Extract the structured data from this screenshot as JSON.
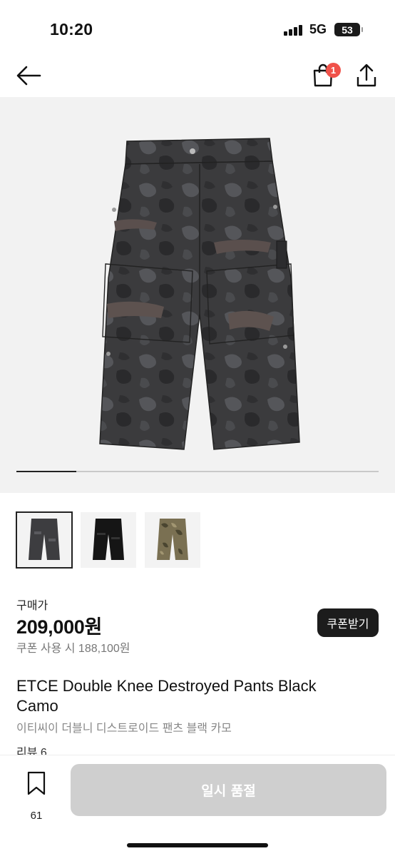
{
  "status": {
    "time": "10:20",
    "network": "5G",
    "battery": "53"
  },
  "nav": {
    "cart_count": "1",
    "icons": [
      "arrow-left-icon",
      "shopping-bag-icon",
      "share-icon"
    ]
  },
  "gallery": {
    "current_index": 0,
    "total": 6,
    "progress_fraction": 0.165
  },
  "thumbnails": [
    {
      "label": "black-camo",
      "selected": true
    },
    {
      "label": "black",
      "selected": false
    },
    {
      "label": "camo",
      "selected": false
    }
  ],
  "price": {
    "label": "구매가",
    "amount": "209,000원",
    "coupon_price": "쿠폰 사용 시 188,100원",
    "coupon_button": "쿠폰받기"
  },
  "product": {
    "name": "ETCE Double Knee Destroyed Pants Black Camo",
    "name_kr": "이티씨이 더블니 디스트로이드 팬츠 블랙 카모",
    "review": "리뷰 6"
  },
  "bottom": {
    "bookmark_count": "61",
    "action_label": "일시 품절"
  },
  "colors": {
    "accent_badge": "#f0524a",
    "dark_button": "#1c1c1c",
    "disabled_button": "#cfcfcf"
  }
}
